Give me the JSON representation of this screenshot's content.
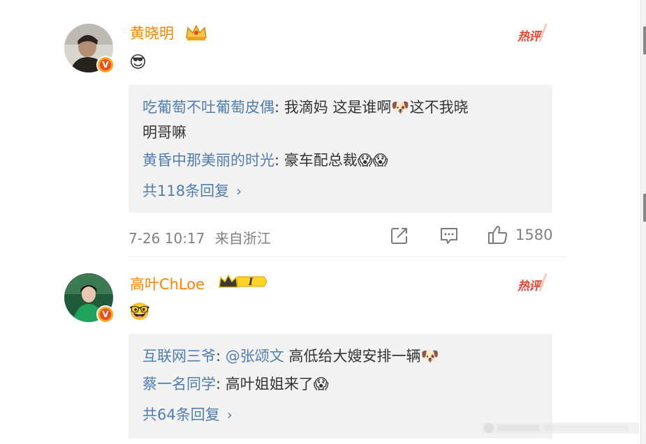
{
  "comments": [
    {
      "username": "黄晓明",
      "crown_icon": "gold-crown-icon",
      "hot_label": "热评",
      "content_emoji": "😎",
      "replies": [
        {
          "author": "吃葡萄不吐葡萄皮偶",
          "text": ": 我滴妈 这是谁啊🐶这不我晓",
          "text_cont": "明哥嘛"
        },
        {
          "author": "黄昏中那美丽的时光",
          "text": ": 豪车配总裁😱😱"
        }
      ],
      "more_replies": "共118条回复",
      "time": "7-26 10:17",
      "source": "来自浙江",
      "like_count": "1580"
    },
    {
      "username": "高叶ChLoe",
      "crown_icon": "member-crown-icon",
      "member_level": "I",
      "hot_label": "热评",
      "content_emoji": "🤓",
      "replies": [
        {
          "author": "互联网三爷",
          "mention": "@张颂文",
          "text": " 高低给大嫂安排一辆🐶"
        },
        {
          "author": "蔡一名同学",
          "text": ": 高叶姐姐来了😱"
        }
      ],
      "more_replies": "共64条回复"
    }
  ],
  "verified_badge": "V"
}
